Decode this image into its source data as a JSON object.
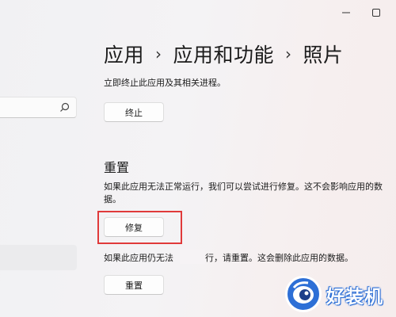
{
  "breadcrumb": {
    "items": [
      "应用",
      "应用和功能",
      "照片"
    ],
    "separator": "›"
  },
  "terminate": {
    "description": "立即终止此应用及其相关进程。",
    "button_label": "终止"
  },
  "repair": {
    "title": "重置",
    "description_line1": "如果此应用无法正常运行，我们可以尝试进行修复。这不会影响应用的数",
    "description_line2": "据。",
    "button_label": "修复"
  },
  "reset": {
    "description_part1": "如果此应用仍无法",
    "description_part2": "行，请重置。这会删除此应用的数据。",
    "button_label": "重置"
  },
  "watermark": {
    "text": "好装机"
  },
  "colors": {
    "highlight": "#e03a3a",
    "watermark_blue": "#2d6fd6"
  },
  "icons": {
    "search": "search-icon",
    "minimize": "minimize-icon",
    "maximize": "maximize-icon"
  }
}
